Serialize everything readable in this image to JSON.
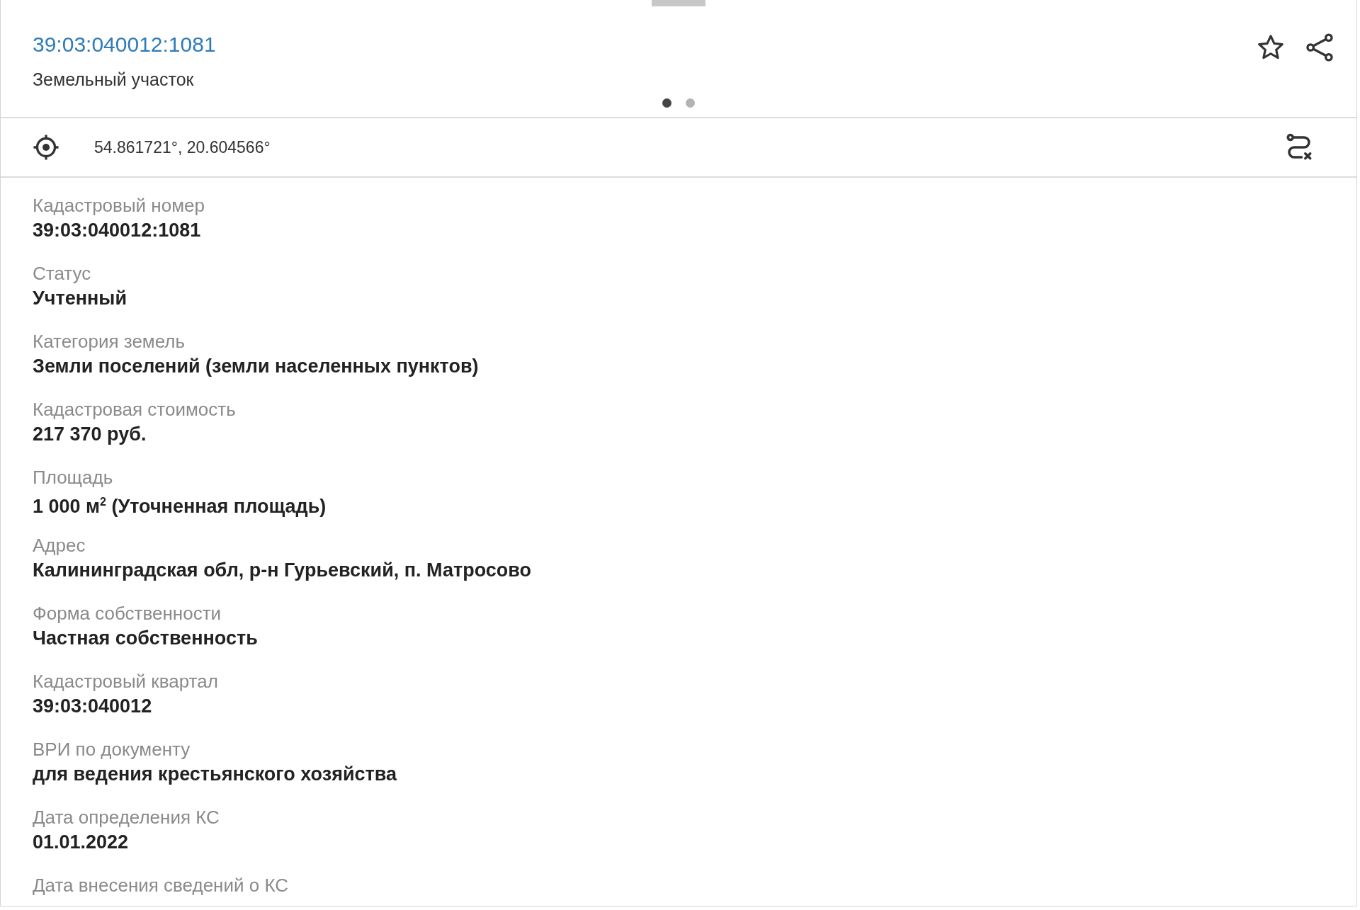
{
  "header": {
    "title": "39:03:040012:1081",
    "subtitle": "Земельный участок"
  },
  "pager": [
    {
      "selected": true
    },
    {
      "selected": false
    }
  ],
  "location": {
    "coordinates": "54.861721°, 20.604566°"
  },
  "fields": [
    {
      "label": "Кадастровый номер",
      "value": "39:03:040012:1081"
    },
    {
      "label": "Статус",
      "value": "Учтенный"
    },
    {
      "label": "Категория земель",
      "value": "Земли поселений (земли населенных пунктов)"
    },
    {
      "label": "Кадастровая стоимость",
      "value": "217 370 руб."
    },
    {
      "label": "Площадь",
      "value": "1 000 м$^{2}$ (Уточненная площадь)"
    },
    {
      "label": "Адрес",
      "value": "Калининградская обл, р-н Гурьевский, п. Матросово"
    },
    {
      "label": "Форма собственности",
      "value": "Частная собственность"
    },
    {
      "label": "Кадастровый квартал",
      "value": "39:03:040012"
    },
    {
      "label": "ВРИ по документу",
      "value": "для ведения крестьянского  хозяйства"
    },
    {
      "label": "Дата определения КС",
      "value": "01.01.2022"
    },
    {
      "label": "Дата внесения сведений о КС"
    }
  ]
}
